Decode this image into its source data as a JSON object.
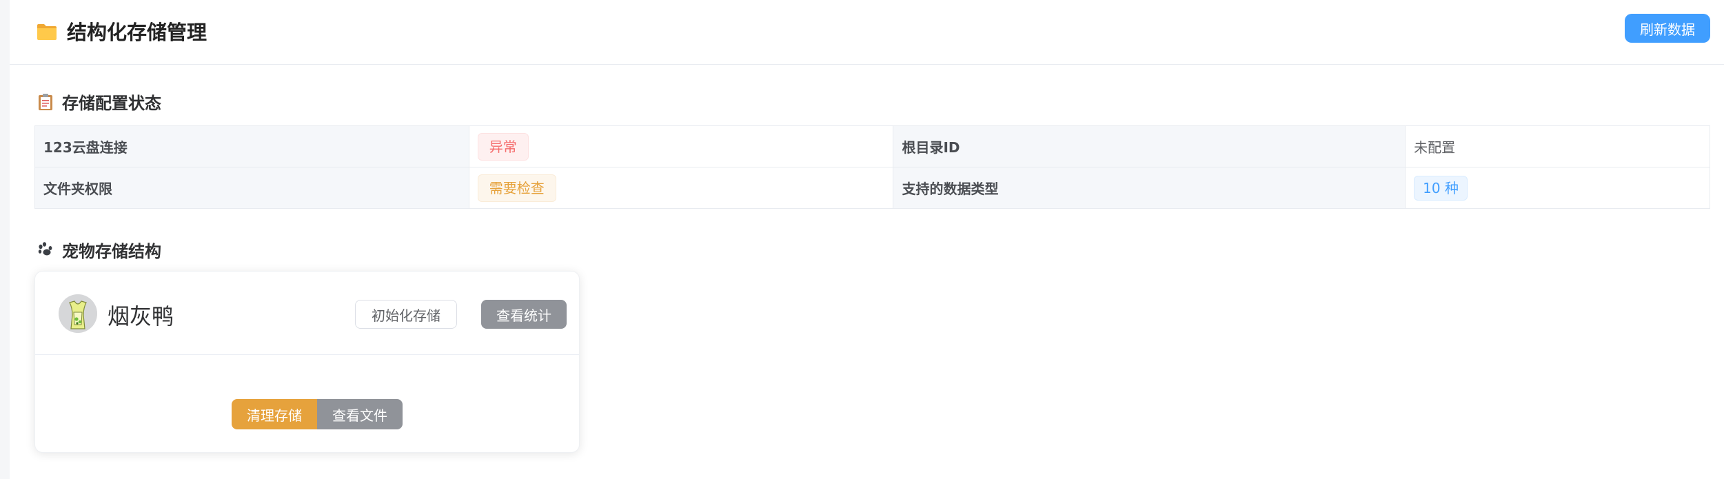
{
  "header": {
    "title": "结构化存储管理",
    "title_icon": "folder-icon",
    "refresh_label": "刷新数据"
  },
  "config_section": {
    "title": "存储配置状态",
    "icon": "clipboard-icon",
    "rows": [
      {
        "label1": "123云盘连接",
        "value1": "异常",
        "label2": "根目录ID",
        "value2": "未配置"
      },
      {
        "label1": "文件夹权限",
        "value1": "需要检查",
        "label2": "支持的数据类型",
        "value2": "10 种"
      }
    ]
  },
  "pet_section": {
    "title": "宠物存储结构",
    "icon": "paw-icon",
    "pet": {
      "name": "烟灰鸭",
      "init_label": "初始化存储",
      "stats_label": "查看统计",
      "clear_label": "清理存储",
      "files_label": "查看文件"
    }
  },
  "colors": {
    "primary": "#409eff",
    "danger": "#f56c6c",
    "warning": "#e6a23c",
    "info": "#909399"
  }
}
